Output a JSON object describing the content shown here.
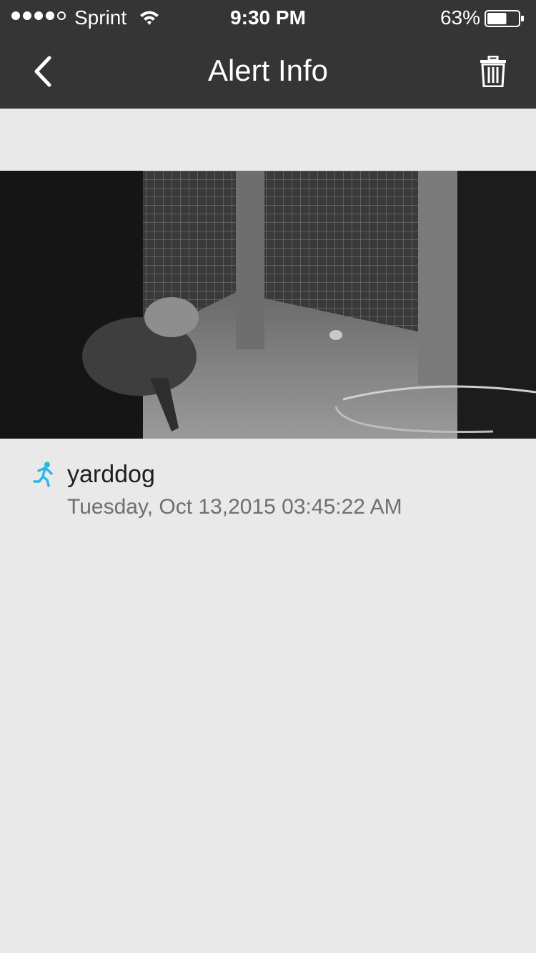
{
  "status_bar": {
    "signal_bars_filled": 4,
    "signal_bars_total": 5,
    "carrier": "Sprint",
    "time": "9:30 PM",
    "battery_percent": "63%",
    "battery_level": 0.63
  },
  "nav": {
    "title": "Alert Info",
    "back_icon": "chevron-left-icon",
    "delete_icon": "trash-icon"
  },
  "alert": {
    "icon": "running-person-icon",
    "camera_name": "yarddog",
    "timestamp": "Tuesday, Oct 13,2015 03:45:22 AM"
  },
  "colors": {
    "nav_background": "#353535",
    "page_background": "#e9e9e9",
    "accent": "#29b6e8",
    "primary_text": "#1e1e1e",
    "secondary_text": "#6f6f6f"
  }
}
